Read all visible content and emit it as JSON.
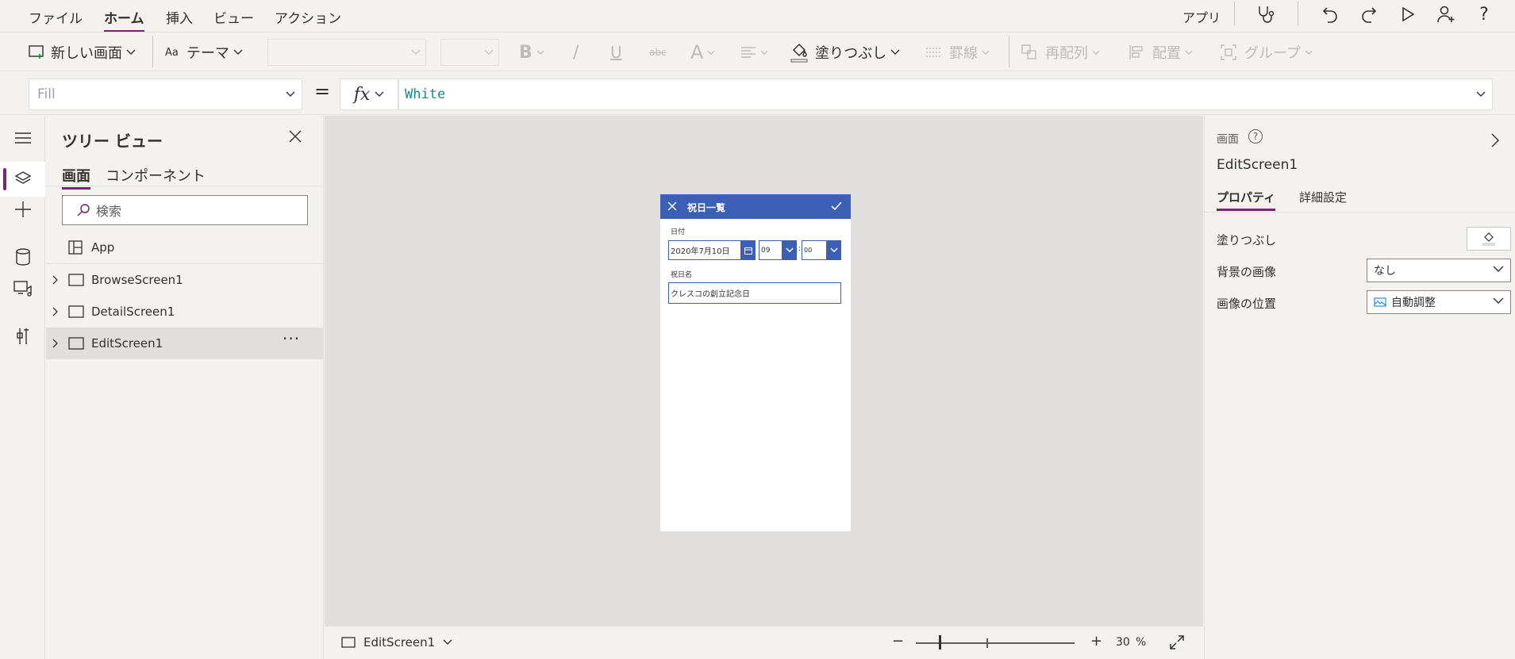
{
  "menu": {
    "tabs": [
      {
        "label": "ファイル"
      },
      {
        "label": "ホーム"
      },
      {
        "label": "挿入"
      },
      {
        "label": "ビュー"
      },
      {
        "label": "アクション"
      }
    ],
    "active_tab": "ホーム",
    "app_label": "アプリ"
  },
  "toolbar": {
    "new_screen": "新しい画面",
    "theme": "テーマ",
    "fill": "塗りつぶし",
    "border": "罫線",
    "reorder": "再配列",
    "align": "配置",
    "group": "グループ",
    "bold_glyph": "B",
    "italic_glyph": "/",
    "underline_glyph": "U",
    "strike_glyph": "abc",
    "font_color_glyph": "A"
  },
  "formula": {
    "property": "Fill",
    "equals": "=",
    "fx": "fx",
    "value": "White"
  },
  "tree": {
    "title": "ツリー ビュー",
    "tabs": [
      {
        "label": "画面"
      },
      {
        "label": "コンポーネント"
      }
    ],
    "search_placeholder": "検索",
    "items": [
      {
        "label": "App"
      },
      {
        "label": "BrowseScreen1"
      },
      {
        "label": "DetailScreen1"
      },
      {
        "label": "EditScreen1"
      }
    ],
    "more": "···"
  },
  "device": {
    "title": "祝日一覧",
    "date_label": "日付",
    "date_value": "2020年7月10日",
    "hour_value": "09",
    "minute_value": "00",
    "colon": ":",
    "name_label": "祝日名",
    "name_value": "クレスコの創立記念日"
  },
  "bottombar": {
    "screen": "EditScreen1",
    "zoom_minus": "−",
    "zoom_plus": "+",
    "zoom_value": "30",
    "zoom_unit": "%",
    "zoom_level_percent": 30
  },
  "rpanel": {
    "kind": "画面",
    "help": "?",
    "name": "EditScreen1",
    "tabs": [
      {
        "label": "プロパティ"
      },
      {
        "label": "詳細設定"
      }
    ],
    "fill_label": "塗りつぶし",
    "bg_image_label": "背景の画像",
    "bg_image_value": "なし",
    "image_pos_label": "画像の位置",
    "image_pos_value": "自動調整"
  },
  "colors": {
    "accent": "#742774",
    "header_blue": "#3a5fb4",
    "formula_text": "#1a8a8a"
  }
}
